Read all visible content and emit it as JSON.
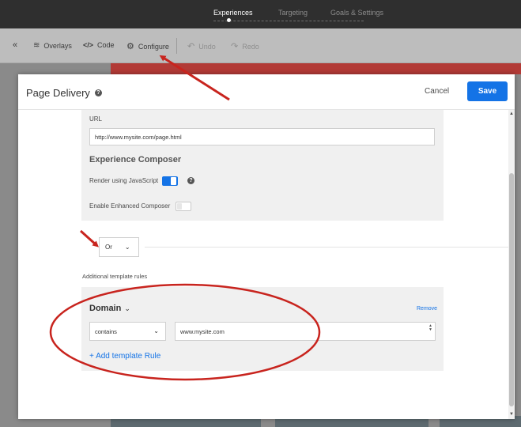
{
  "topbar": {
    "steps": [
      {
        "label": "Experiences",
        "active": true
      },
      {
        "label": "Targeting",
        "active": false
      },
      {
        "label": "Goals & Settings",
        "active": false
      }
    ]
  },
  "toolbar": {
    "collapse_icon": "double-chevron-left-icon",
    "overlays_label": "Overlays",
    "code_label": "Code",
    "configure_label": "Configure",
    "undo_label": "Undo",
    "redo_label": "Redo"
  },
  "modal": {
    "title": "Page Delivery",
    "cancel_label": "Cancel",
    "save_label": "Save",
    "url": {
      "label": "URL",
      "value": "http://www.mysite.com/page.html"
    },
    "composer": {
      "heading": "Experience Composer",
      "render_js_label": "Render using JavaScript",
      "render_js_on": true,
      "enhanced_label": "Enable Enhanced Composer",
      "enhanced_on": false
    },
    "or_select": {
      "value": "Or"
    },
    "additional_label": "Additional template rules",
    "rule": {
      "field": "Domain",
      "remove_label": "Remove",
      "operator": "contains",
      "value": "www.mysite.com"
    },
    "add_rule_label": "+ Add template Rule"
  },
  "colors": {
    "accent": "#1473e6",
    "annotation": "#c8241e"
  }
}
